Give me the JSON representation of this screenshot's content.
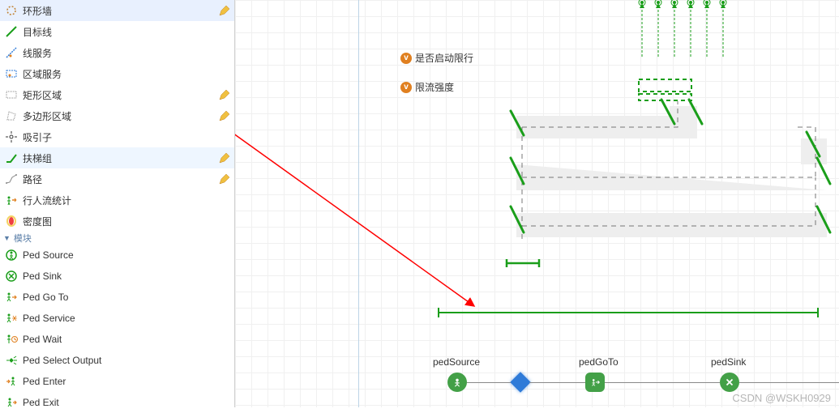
{
  "sidebar": {
    "items": [
      {
        "id": "wall",
        "label": "环形墙",
        "edit": true
      },
      {
        "id": "target-line",
        "label": "目标线",
        "edit": false
      },
      {
        "id": "line-service",
        "label": "线服务",
        "edit": false
      },
      {
        "id": "area-service",
        "label": "区域服务",
        "edit": false
      },
      {
        "id": "rect-area",
        "label": "矩形区域",
        "edit": true
      },
      {
        "id": "poly-area",
        "label": "多边形区域",
        "edit": true
      },
      {
        "id": "attractor",
        "label": "吸引子",
        "edit": false
      },
      {
        "id": "escalator-group",
        "label": "扶梯组",
        "edit": true
      },
      {
        "id": "path",
        "label": "路径",
        "edit": true
      },
      {
        "id": "ped-stats",
        "label": "行人流统计",
        "edit": false
      },
      {
        "id": "density-map",
        "label": "密度图",
        "edit": false
      }
    ],
    "section2_label": "模块",
    "blocks": [
      {
        "id": "ped-source",
        "label": "Ped Source"
      },
      {
        "id": "ped-sink",
        "label": "Ped Sink"
      },
      {
        "id": "ped-goto",
        "label": "Ped Go To"
      },
      {
        "id": "ped-service",
        "label": "Ped Service"
      },
      {
        "id": "ped-wait",
        "label": "Ped Wait"
      },
      {
        "id": "ped-select-output",
        "label": "Ped Select Output"
      },
      {
        "id": "ped-enter",
        "label": "Ped Enter"
      },
      {
        "id": "ped-exit",
        "label": "Ped Exit"
      }
    ]
  },
  "canvas": {
    "labels": {
      "var1": "是否启动限行",
      "var2": "限流强度"
    },
    "blocks": {
      "source": "pedSource",
      "goto": "pedGoTo",
      "sink": "pedSink"
    }
  },
  "icons": {
    "pencil_color": "#e0a030",
    "accent_green": "#1a9e1a",
    "block_green": "#43a047",
    "diamond_blue": "#2f7bd8"
  },
  "watermark": "CSDN @WSKH0929"
}
